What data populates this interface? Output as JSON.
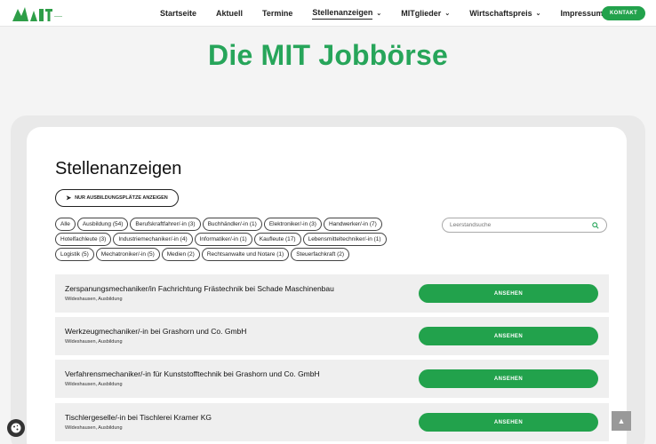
{
  "nav": {
    "items": [
      {
        "label": "Startseite",
        "dropdown": false,
        "active": false
      },
      {
        "label": "Aktuell",
        "dropdown": false,
        "active": false
      },
      {
        "label": "Termine",
        "dropdown": false,
        "active": false
      },
      {
        "label": "Stellenanzeigen",
        "dropdown": true,
        "active": true
      },
      {
        "label": "MITglieder",
        "dropdown": true,
        "active": false
      },
      {
        "label": "Wirtschaftspreis",
        "dropdown": true,
        "active": false
      },
      {
        "label": "Impressum",
        "dropdown": true,
        "active": false
      }
    ],
    "contact_label": "KONTAKT"
  },
  "hero": {
    "title": "Die MIT Jobbörse"
  },
  "section": {
    "title": "Stellenanzeigen",
    "apprentice_button": "NUR AUSBILDUNGSPLÄTZE ANZEIGEN"
  },
  "filters": [
    [
      "Alle",
      "Ausbildung (54)",
      "Berufskraftfahrer/-in (3)",
      "Buchhändler/-in (1)",
      "Elektroniker/-in (3)",
      "Handwerker/-in (7)"
    ],
    [
      "Hotelfachleute (3)",
      "Industriemechaniker/-in (4)",
      "Informatiker/-in (1)",
      "Kaufleute (17)",
      "Lebensmitteltechniker/-in (1)"
    ],
    [
      "Logistik (5)",
      "Mechatroniker/-in (5)",
      "Medien (2)",
      "Rechtsanwalte und Notare (1)",
      "Steuerfachkraft (2)"
    ]
  ],
  "search": {
    "placeholder": "Leerstandsuche"
  },
  "jobs": [
    {
      "title": "Zerspanungsmechaniker/in Fachrichtung Frästechnik bei Schade Maschinenbau",
      "meta": "Wildeshausen, Ausbildung",
      "button": "ANSEHEN"
    },
    {
      "title": "Werkzeugmechaniker/-in bei Grashorn und Co. GmbH",
      "meta": "Wildeshausen, Ausbildung",
      "button": "ANSEHEN"
    },
    {
      "title": "Verfahrensmechaniker/-in für Kunststofftechnik bei Grashorn und Co. GmbH",
      "meta": "Wildeshausen, Ausbildung",
      "button": "ANSEHEN"
    },
    {
      "title": "Tischlergeselle/-in bei Tischlerei Kramer KG",
      "meta": "Wildeshausen, Ausbildung",
      "button": "ANSEHEN"
    }
  ],
  "colors": {
    "brand_green": "#22a24c",
    "title_green": "#27a55a"
  },
  "icons": {
    "logo": "mit-logo",
    "search": "search-icon",
    "rocket": "rocket-icon",
    "cookie": "cookie-icon",
    "scroll_top": "arrow-up-icon"
  }
}
